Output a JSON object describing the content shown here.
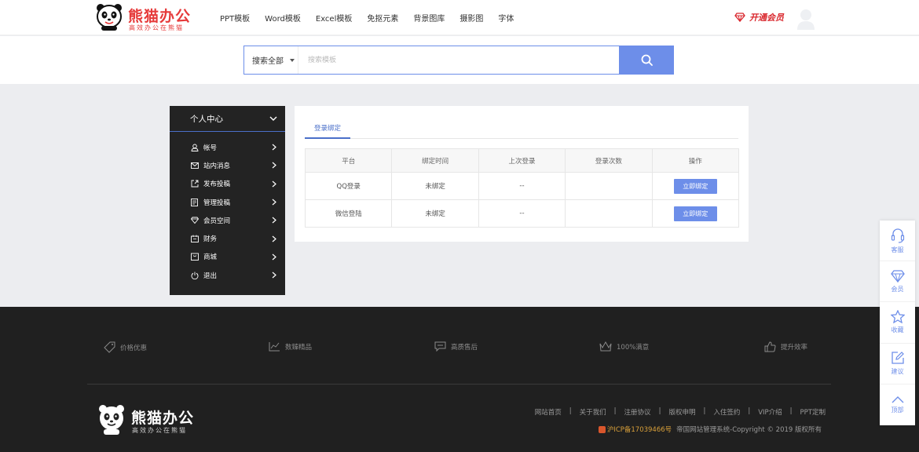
{
  "header": {
    "brand": "熊猫办公",
    "slogan": "高效办公在熊猫",
    "nav": [
      "PPT模板",
      "Word模板",
      "Excel模板",
      "免抠元素",
      "背景图库",
      "摄影图",
      "字体"
    ],
    "vip_label": "开通会员"
  },
  "search": {
    "scope": "搜索全部",
    "placeholder": "搜索模板"
  },
  "sidebar": {
    "title": "个人中心",
    "items": [
      {
        "label": "帐号",
        "icon": "user-icon"
      },
      {
        "label": "站内消息",
        "icon": "mail-icon"
      },
      {
        "label": "发布投稿",
        "icon": "external-link-icon"
      },
      {
        "label": "管理投稿",
        "icon": "document-icon"
      },
      {
        "label": "会员空间",
        "icon": "diamond-icon"
      },
      {
        "label": "财务",
        "icon": "wallet-icon"
      },
      {
        "label": "商城",
        "icon": "shop-icon"
      },
      {
        "label": "退出",
        "icon": "power-icon"
      }
    ]
  },
  "panel": {
    "tab": "登录绑定",
    "columns": [
      "平台",
      "绑定时间",
      "上次登录",
      "登录次数",
      "操作"
    ],
    "rows": [
      {
        "platform": "QQ登录",
        "bind_time": "未绑定",
        "last_login": "--",
        "count": "",
        "action": "立即绑定"
      },
      {
        "platform": "微信登陆",
        "bind_time": "未绑定",
        "last_login": "--",
        "count": "",
        "action": "立即绑定"
      }
    ]
  },
  "floatbar": [
    "客服",
    "会员",
    "收藏",
    "建议",
    "顶部"
  ],
  "footer": {
    "features": [
      "价格优惠",
      "数臻精品",
      "高质售后",
      "100%满意",
      "提升效率"
    ],
    "brand": "熊猫办公",
    "slogan": "高效办公在熊猫",
    "links": [
      "网站首页",
      "关于我们",
      "注册协议",
      "版权申明",
      "入住签约",
      "VIP介绍",
      "PPT定制"
    ],
    "icp": "沪ICP备17039466号",
    "copyright": "帝国网站管理系统-Copyright © 2019 版权所有"
  },
  "colors": {
    "accent": "#6d8ee9",
    "brand_red": "#e63a3a",
    "sidebar_bg": "#232323",
    "footer_bg": "#202020"
  }
}
